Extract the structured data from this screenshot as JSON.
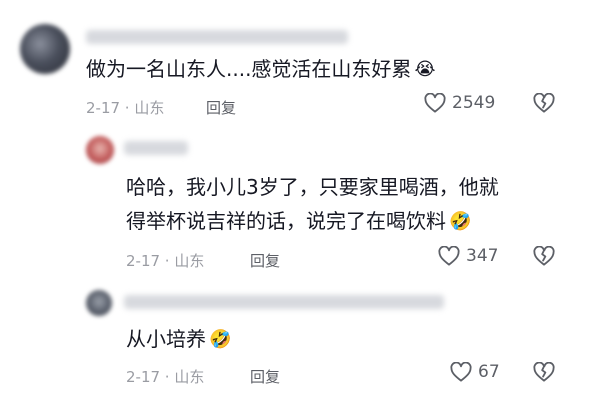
{
  "comments": [
    {
      "text": "做为一名山东人....感觉活在山东好累",
      "emoji": "😭",
      "meta": "2-17 · 山东",
      "reply": "回复",
      "likes": "2549"
    },
    {
      "text_line1": "哈哈，我小儿3岁了，只要家里喝酒，他就",
      "text_line2": "得举杯说吉祥的话，说完了在喝饮料",
      "emoji": "🤣",
      "meta": "2-17 · 山东",
      "reply": "回复",
      "likes": "347"
    },
    {
      "text": "从小培养",
      "emoji": "🤣",
      "meta": "2-17 · 山东",
      "reply": "回复",
      "likes": "67"
    }
  ],
  "icons": {
    "like": "heart-outline-icon",
    "dislike": "broken-heart-outline-icon"
  },
  "colors": {
    "text": "#161823",
    "meta": "#9a9ca3",
    "action": "#5c5f66"
  }
}
